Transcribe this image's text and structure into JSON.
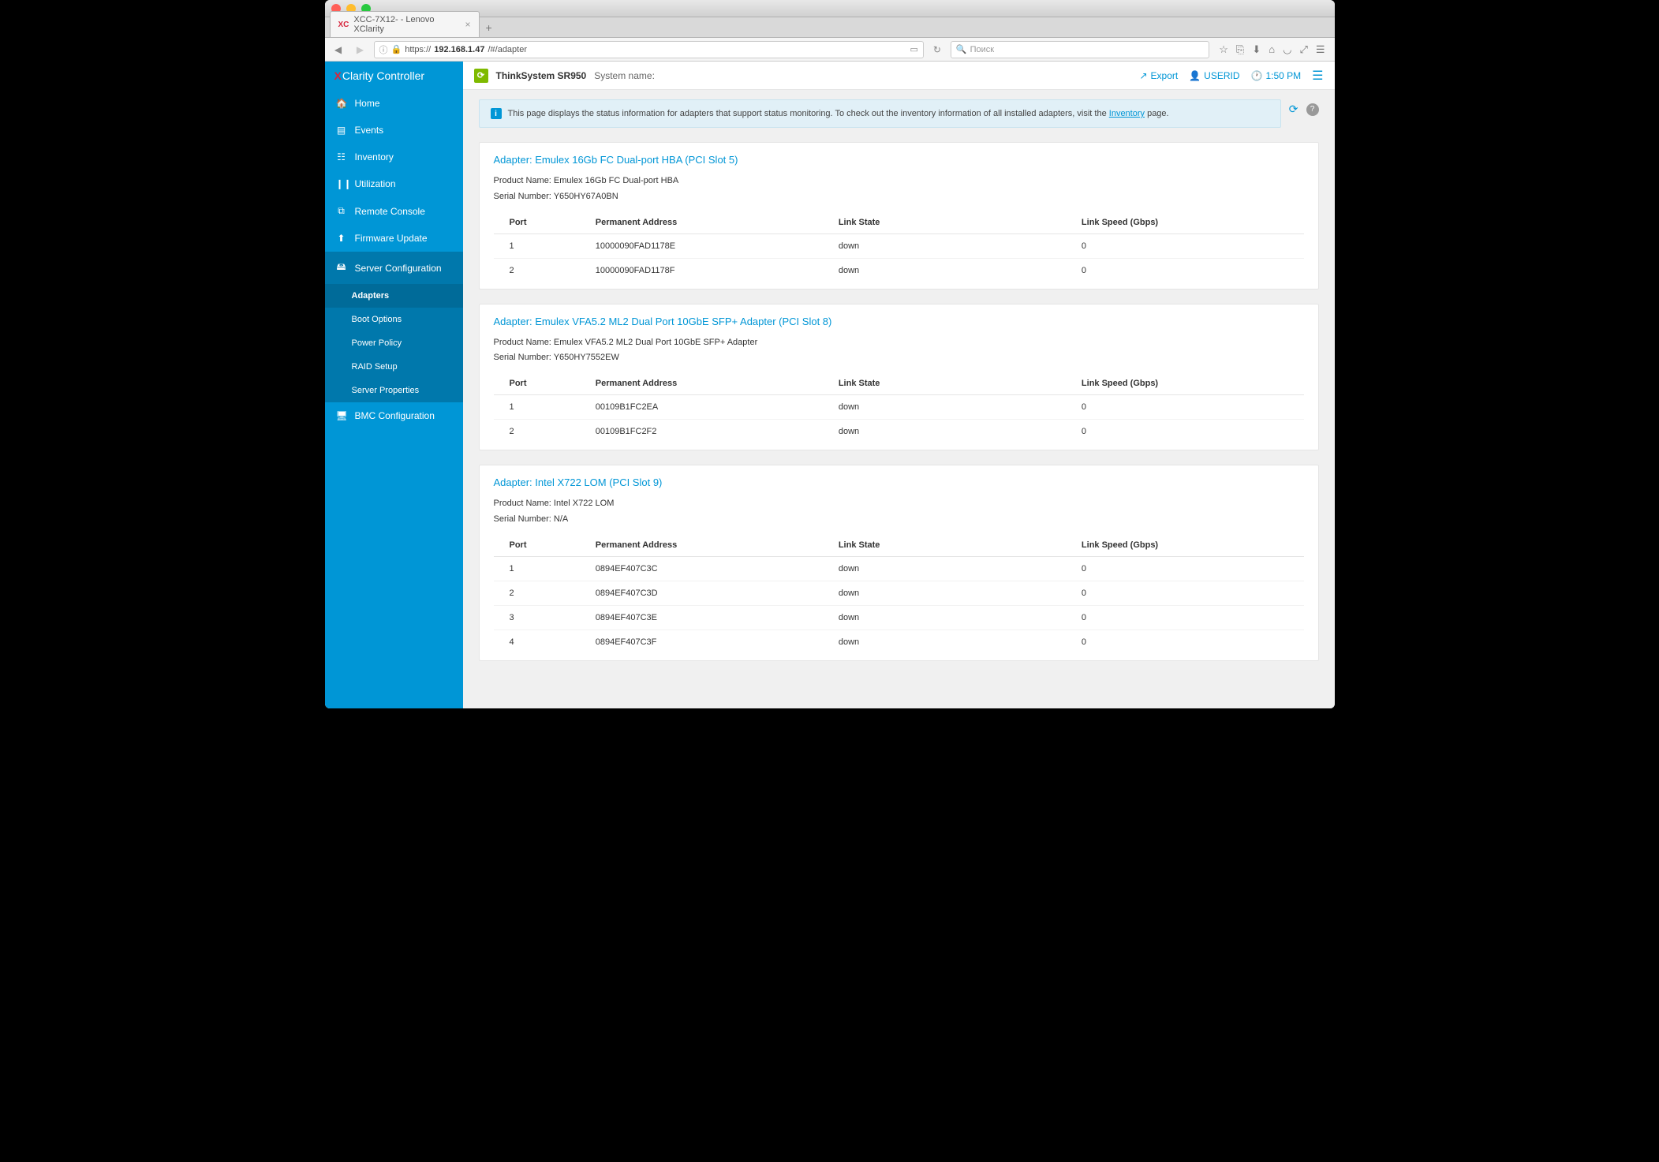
{
  "browser": {
    "tab_title": "XCC-7X12- - Lenovo XClarity",
    "url_prefix": "https://",
    "url_host": "192.168.1.47",
    "url_path": "/#/adapter",
    "search_placeholder": "Поиск"
  },
  "brand": {
    "prefix": "Clarity",
    "suffix": "Controller"
  },
  "sidebar": {
    "items": [
      {
        "icon": "🏠",
        "label": "Home"
      },
      {
        "icon": "▤",
        "label": "Events"
      },
      {
        "icon": "☷",
        "label": "Inventory"
      },
      {
        "icon": "❙❙",
        "label": "Utilization"
      },
      {
        "icon": "⧉",
        "label": "Remote Console"
      },
      {
        "icon": "⬆",
        "label": "Firmware Update"
      },
      {
        "icon": "🖴",
        "label": "Server Configuration"
      },
      {
        "icon": "🖥",
        "label": "BMC Configuration"
      }
    ],
    "sub": [
      {
        "label": "Adapters",
        "active": true
      },
      {
        "label": "Boot Options"
      },
      {
        "label": "Power Policy"
      },
      {
        "label": "RAID Setup"
      },
      {
        "label": "Server Properties"
      }
    ]
  },
  "topbar": {
    "product": "ThinkSystem SR950",
    "sysname_label": "System name:",
    "export": "Export",
    "user": "USERID",
    "time": "1:50 PM"
  },
  "banner": {
    "text_before": "This page displays the status information for adapters that support status monitoring. To check out the inventory information of all installed adapters, visit the ",
    "link": "Inventory",
    "text_after": " page."
  },
  "table_headers": {
    "port": "Port",
    "addr": "Permanent Address",
    "link": "Link State",
    "speed": "Link Speed (Gbps)"
  },
  "labels": {
    "product_name": "Product Name: ",
    "serial": "Serial Number: "
  },
  "adapters": [
    {
      "title": "Adapter: Emulex 16Gb FC Dual-port HBA (PCI Slot 5)",
      "product": "Emulex 16Gb FC Dual-port HBA",
      "serial": "Y650HY67A0BN",
      "ports": [
        {
          "port": "1",
          "addr": "10000090FAD1178E",
          "link": "down",
          "speed": "0"
        },
        {
          "port": "2",
          "addr": "10000090FAD1178F",
          "link": "down",
          "speed": "0"
        }
      ]
    },
    {
      "title": "Adapter: Emulex VFA5.2 ML2 Dual Port 10GbE SFP+ Adapter (PCI Slot 8)",
      "product": "Emulex VFA5.2 ML2 Dual Port 10GbE SFP+ Adapter",
      "serial": "Y650HY7552EW",
      "ports": [
        {
          "port": "1",
          "addr": "00109B1FC2EA",
          "link": "down",
          "speed": "0"
        },
        {
          "port": "2",
          "addr": "00109B1FC2F2",
          "link": "down",
          "speed": "0"
        }
      ]
    },
    {
      "title": "Adapter: Intel X722 LOM (PCI Slot 9)",
      "product": "Intel X722 LOM",
      "serial": "N/A",
      "ports": [
        {
          "port": "1",
          "addr": "0894EF407C3C",
          "link": "down",
          "speed": "0"
        },
        {
          "port": "2",
          "addr": "0894EF407C3D",
          "link": "down",
          "speed": "0"
        },
        {
          "port": "3",
          "addr": "0894EF407C3E",
          "link": "down",
          "speed": "0"
        },
        {
          "port": "4",
          "addr": "0894EF407C3F",
          "link": "down",
          "speed": "0"
        }
      ]
    }
  ]
}
